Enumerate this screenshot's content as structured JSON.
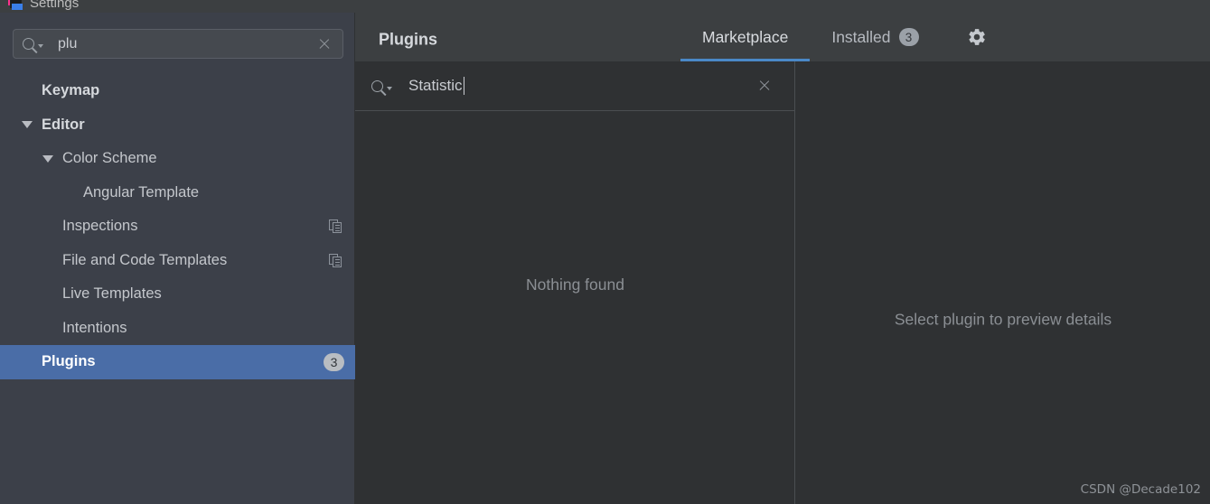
{
  "window": {
    "title": "Settings",
    "app_icon": "intellij-app-icon"
  },
  "sidebar": {
    "search": {
      "value": "plu",
      "placeholder": "",
      "search_icon": "search-icon",
      "clear_icon": "clear-icon"
    },
    "items": [
      {
        "label": "Keymap",
        "depth": 0,
        "bold": true,
        "twisty": "none",
        "selected": false,
        "badge": null,
        "copy_icon": false
      },
      {
        "label": "Editor",
        "depth": 0,
        "bold": true,
        "twisty": "expanded",
        "selected": false,
        "badge": null,
        "copy_icon": false
      },
      {
        "label": "Color Scheme",
        "depth": 1,
        "bold": false,
        "twisty": "expanded",
        "selected": false,
        "badge": null,
        "copy_icon": false
      },
      {
        "label": "Angular Template",
        "depth": 2,
        "bold": false,
        "twisty": "none",
        "selected": false,
        "badge": null,
        "copy_icon": false
      },
      {
        "label": "Inspections",
        "depth": 1,
        "bold": false,
        "twisty": "none",
        "selected": false,
        "badge": null,
        "copy_icon": true
      },
      {
        "label": "File and Code Templates",
        "depth": 1,
        "bold": false,
        "twisty": "none",
        "selected": false,
        "badge": null,
        "copy_icon": true
      },
      {
        "label": "Live Templates",
        "depth": 1,
        "bold": false,
        "twisty": "none",
        "selected": false,
        "badge": null,
        "copy_icon": false
      },
      {
        "label": "Intentions",
        "depth": 1,
        "bold": false,
        "twisty": "none",
        "selected": false,
        "badge": null,
        "copy_icon": false
      },
      {
        "label": "Plugins",
        "depth": 0,
        "bold": true,
        "twisty": "none",
        "selected": true,
        "badge": "3",
        "copy_icon": false
      }
    ]
  },
  "header": {
    "title": "Plugins",
    "tabs": [
      {
        "label": "Marketplace",
        "badge": null,
        "active": true
      },
      {
        "label": "Installed",
        "badge": "3",
        "active": false
      }
    ],
    "settings_icon": "gear-icon"
  },
  "plugin_list": {
    "search": {
      "value": "Statistic",
      "placeholder": "",
      "search_icon": "search-icon",
      "clear_icon": "clear-icon",
      "caret_visible": true
    },
    "empty_message": "Nothing found"
  },
  "preview": {
    "message": "Select plugin to preview details"
  },
  "watermark": {
    "text": "CSDN @Decade102"
  },
  "colors": {
    "sidebar_bg": "#3c4049",
    "content_bg": "#2f3133",
    "header_bg": "#3c3f41",
    "selection_blue": "#4a6da7",
    "tab_underline": "#4a88c7",
    "text_primary": "#c4c7cc",
    "text_muted": "#8b8f94"
  }
}
